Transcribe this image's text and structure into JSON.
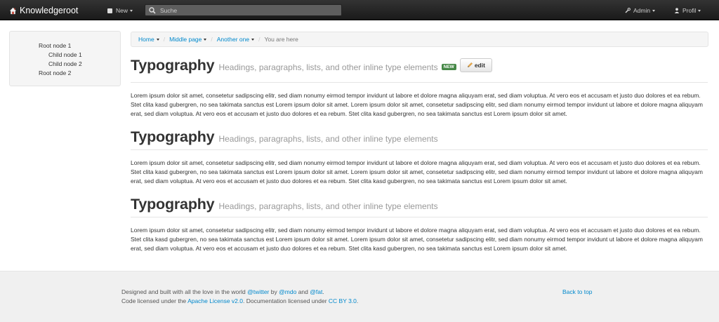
{
  "navbar": {
    "brand": "Knowledgeroot",
    "new_label": "New",
    "search_placeholder": "Suche",
    "admin_label": "Admin",
    "profile_label": "Profil"
  },
  "tree": {
    "items": [
      {
        "label": "Root node 1"
      },
      {
        "label": "Child node 1"
      },
      {
        "label": "Child node 2"
      },
      {
        "label": "Root node 2"
      }
    ]
  },
  "breadcrumb": {
    "items": [
      "Home",
      "Middle page",
      "Another one"
    ],
    "current": "You are here"
  },
  "sections": [
    {
      "title": "Typography",
      "subtitle": "Headings, paragraphs, lists, and other inline type elements",
      "badge": "NEW",
      "edit_label": "edit",
      "text": "Lorem ipsum dolor sit amet, consetetur sadipscing elitr, sed diam nonumy eirmod tempor invidunt ut labore et dolore magna aliquyam erat, sed diam voluptua. At vero eos et accusam et justo duo dolores et ea rebum. Stet clita kasd gubergren, no sea takimata sanctus est Lorem ipsum dolor sit amet. Lorem ipsum dolor sit amet, consetetur sadipscing elitr, sed diam nonumy eirmod tempor invidunt ut labore et dolore magna aliquyam erat, sed diam voluptua. At vero eos et accusam et justo duo dolores et ea rebum. Stet clita kasd gubergren, no sea takimata sanctus est Lorem ipsum dolor sit amet."
    },
    {
      "title": "Typography",
      "subtitle": "Headings, paragraphs, lists, and other inline type elements",
      "text": "Lorem ipsum dolor sit amet, consetetur sadipscing elitr, sed diam nonumy eirmod tempor invidunt ut labore et dolore magna aliquyam erat, sed diam voluptua. At vero eos et accusam et justo duo dolores et ea rebum. Stet clita kasd gubergren, no sea takimata sanctus est Lorem ipsum dolor sit amet. Lorem ipsum dolor sit amet, consetetur sadipscing elitr, sed diam nonumy eirmod tempor invidunt ut labore et dolore magna aliquyam erat, sed diam voluptua. At vero eos et accusam et justo duo dolores et ea rebum. Stet clita kasd gubergren, no sea takimata sanctus est Lorem ipsum dolor sit amet."
    },
    {
      "title": "Typography",
      "subtitle": "Headings, paragraphs, lists, and other inline type elements",
      "text": "Lorem ipsum dolor sit amet, consetetur sadipscing elitr, sed diam nonumy eirmod tempor invidunt ut labore et dolore magna aliquyam erat, sed diam voluptua. At vero eos et accusam et justo duo dolores et ea rebum. Stet clita kasd gubergren, no sea takimata sanctus est Lorem ipsum dolor sit amet. Lorem ipsum dolor sit amet, consetetur sadipscing elitr, sed diam nonumy eirmod tempor invidunt ut labore et dolore magna aliquyam erat, sed diam voluptua. At vero eos et accusam et justo duo dolores et ea rebum. Stet clita kasd gubergren, no sea takimata sanctus est Lorem ipsum dolor sit amet."
    }
  ],
  "footer": {
    "line1_prefix": "Designed and built with all the love in the world",
    "twitter": "@twitter",
    "by": "by",
    "mdo": "@mdo",
    "and": "and",
    "fat": "@fat",
    "line1_suffix": ".",
    "line2_prefix": "Code licensed under the",
    "apache": "Apache License v2.0",
    "line2_mid": ". Documentation licensed under",
    "ccby": "CC BY 3.0",
    "line2_suffix": ".",
    "back_to_top": "Back to top"
  },
  "colors": {
    "link": "#0088cc",
    "badge_new": "#468847",
    "navbar": "#222222"
  }
}
